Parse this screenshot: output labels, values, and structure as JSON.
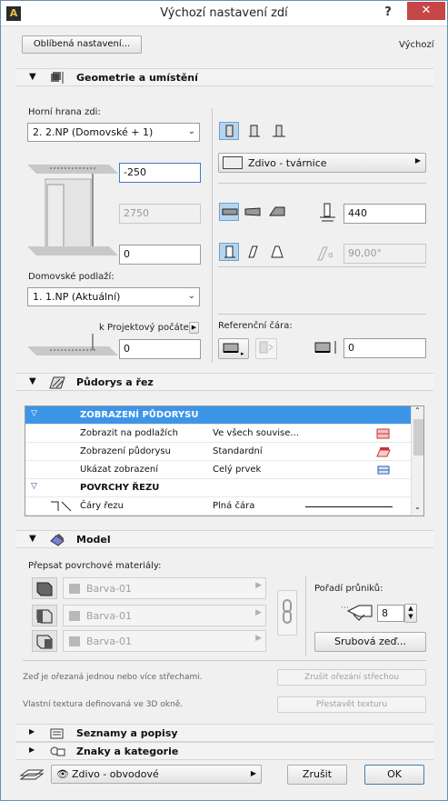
{
  "window": {
    "title": "Výchozí nastavení zdí",
    "help": "?",
    "close": "✕",
    "app_icon": "archicad-icon"
  },
  "top": {
    "favorites_button": "Oblíbená nastavení...",
    "default_label": "Výchozí"
  },
  "sections": {
    "geometry": "Geometrie a umístění",
    "floorplan": "Půdorys a řez",
    "model": "Model",
    "listing": "Seznamy a popisy",
    "tags": "Znaky a kategorie"
  },
  "geometry": {
    "top_link_label": "Horní hrana zdi:",
    "top_link_value": "2. 2.NP (Domovské + 1)",
    "top_offset": "-250",
    "height": "2750",
    "bottom_offset": "0",
    "home_story_label": "Domovské podlaží:",
    "home_story_value": "1. 1.NP (Aktuální)",
    "to_project_zero_label": "k Projektový počátek",
    "to_project_zero_value": "0",
    "structure_value": "Zdivo - tvárnice",
    "thickness": "440",
    "slant_angle": "90,00°",
    "reference_line_label": "Referenční čára:",
    "reference_offset": "0"
  },
  "floorplan_table": {
    "rows": [
      {
        "type": "head",
        "label": "ZOBRAZENÍ PŮDORYSU",
        "value": ""
      },
      {
        "type": "item",
        "label": "Zobrazit na podlažích",
        "value": "Ve všech souvise..."
      },
      {
        "type": "item",
        "label": "Zobrazení půdorysu",
        "value": "Standardní"
      },
      {
        "type": "item",
        "label": "Ukázat zobrazení",
        "value": "Celý prvek"
      },
      {
        "type": "group",
        "label": "POVRCHY ŘEZU",
        "value": ""
      },
      {
        "type": "item",
        "label": "Čáry řezu",
        "value": "Plná čára"
      }
    ]
  },
  "model": {
    "override_label": "Přepsat povrchové materiály:",
    "materials": [
      "Barva-01",
      "Barva-01",
      "Barva-01"
    ],
    "intersection_label": "Pořadí průniků:",
    "intersection_value": "8",
    "log_button": "Srubová zeď...",
    "roof_cut_text": "Zeď je ořezaná jednou nebo více střechami.",
    "roof_cut_button": "Zrušit ořezání střechou",
    "texture_text": "Vlastní textura definovaná ve 3D okně.",
    "texture_button": "Přestavět texturu"
  },
  "footer": {
    "layer_value": "Zdivo - obvodové",
    "cancel": "Zrušit",
    "ok": "OK"
  },
  "colors": {
    "selection": "#3d95e8",
    "close": "#c74646"
  }
}
